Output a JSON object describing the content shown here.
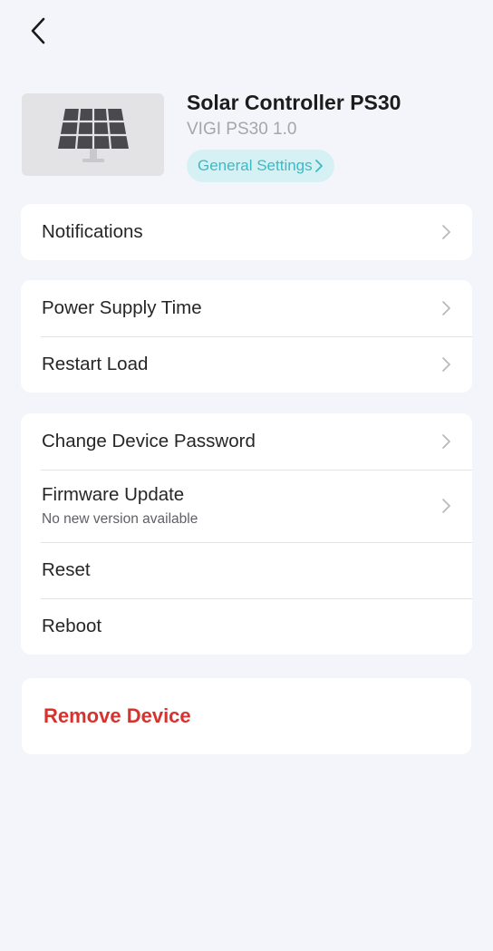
{
  "header": {
    "back_icon": "chevron-left-icon"
  },
  "device": {
    "name": "Solar Controller PS30",
    "model": "VIGI PS30 1.0",
    "image_icon": "solar-panel-icon",
    "general_settings_label": "General Settings"
  },
  "groups": {
    "notifications": {
      "label": "Notifications"
    },
    "power": {
      "power_supply_time": "Power Supply Time",
      "restart_load": "Restart Load"
    },
    "system": {
      "change_password": "Change Device Password",
      "firmware_update": "Firmware Update",
      "firmware_status": "No new version available",
      "reset": "Reset",
      "reboot": "Reboot"
    }
  },
  "remove": {
    "label": "Remove Device"
  },
  "colors": {
    "background": "#f4f5fa",
    "accent": "#3fb9c2",
    "danger": "#d8322f"
  }
}
